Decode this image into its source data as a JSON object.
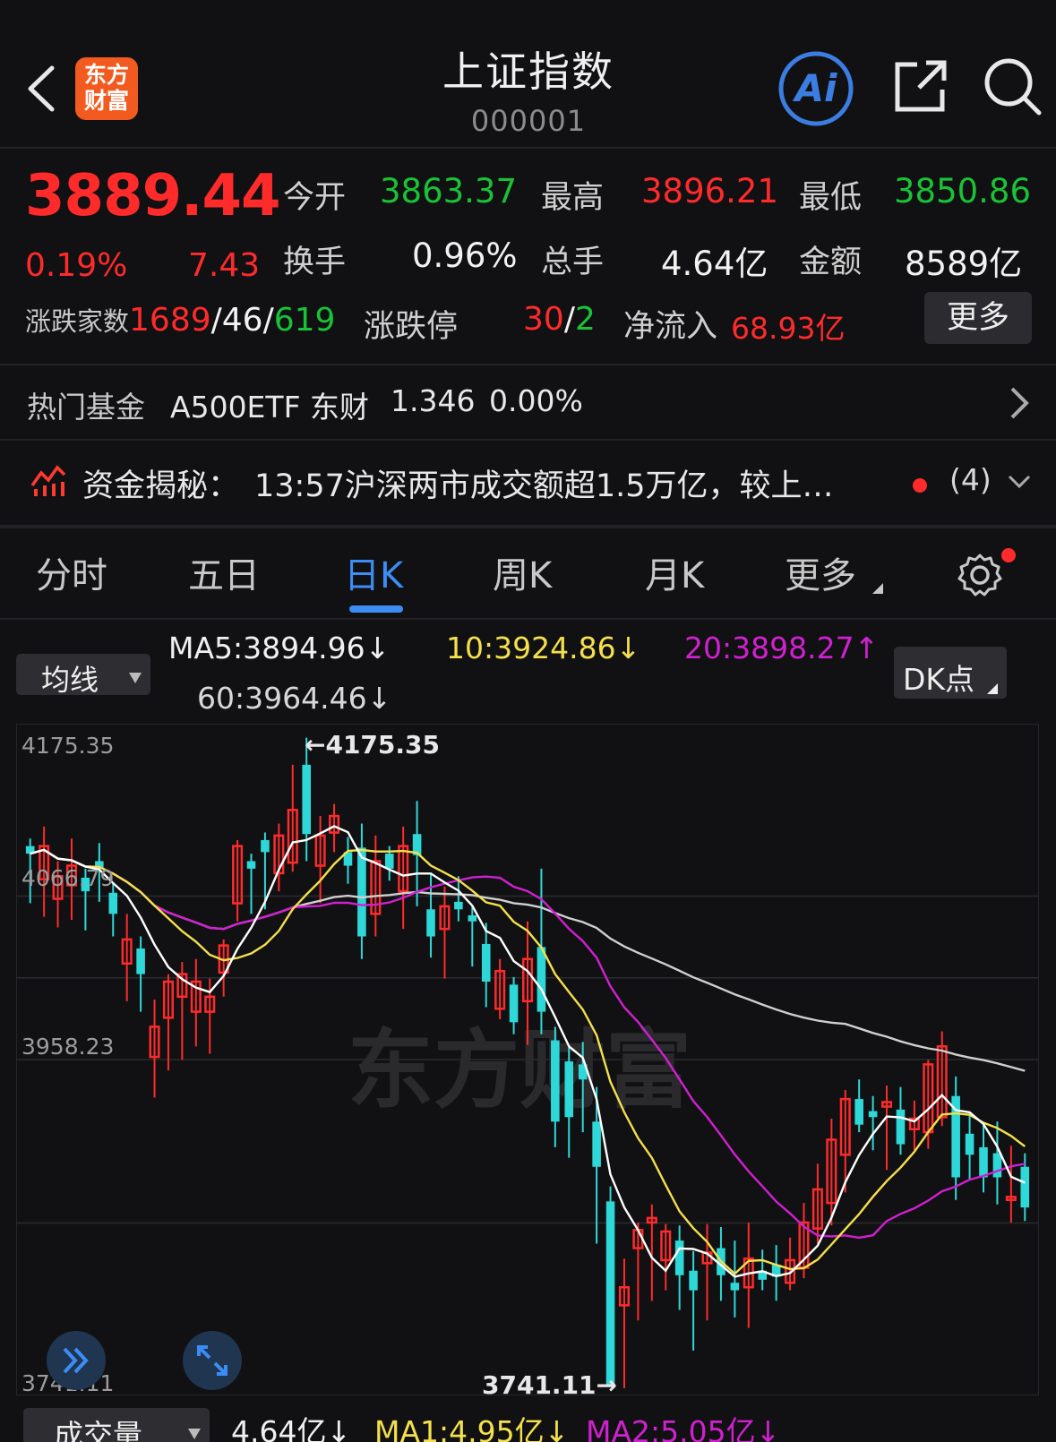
{
  "header": {
    "title": "上证指数",
    "code": "000001",
    "logo_text_line1": "东方",
    "logo_text_line2": "财富",
    "ai_label": "Ai"
  },
  "quote": {
    "price": "3889.44",
    "change_pct": "0.19%",
    "change_abs": "7.43",
    "open_label": "今开",
    "open": "3863.37",
    "high_label": "最高",
    "high": "3896.21",
    "low_label": "最低",
    "low": "3850.86",
    "turnover_label": "换手",
    "turnover": "0.96%",
    "volume_label": "总手",
    "volume": "4.64亿",
    "amount_label": "金额",
    "amount": "8589亿",
    "breadth_label": "涨跌家数",
    "breadth_up": "1689",
    "breadth_flat": "46",
    "breadth_down": "619",
    "limit_label": "涨跌停",
    "limit_up": "30",
    "limit_down": "2",
    "inflow_label": "净流入",
    "inflow": "68.93亿",
    "more_label": "更多",
    "sep": "/"
  },
  "hot_fund": {
    "label": "热门基金",
    "name": "A500ETF 东财",
    "price": "1.346",
    "pct": "0.00%"
  },
  "news": {
    "title": "资金揭秘：",
    "text": "13:57沪深两市成交额超1.5万亿，较上…",
    "count": "(4)"
  },
  "tabs": [
    "分时",
    "五日",
    "日K",
    "周K",
    "月K",
    "更多"
  ],
  "ma_bar": {
    "selector": "均线",
    "ma5": "MA5:3894.96↓",
    "ma10": "10:3924.86↓",
    "ma20": "20:3898.27↑",
    "ma60": "60:3964.46↓",
    "dk_label": "DK点"
  },
  "volume_bar": {
    "selector": "成交量",
    "vol": "4.64亿↓",
    "ma1": "MA1:4.95亿↓",
    "ma2": "MA2:5.05亿↓"
  },
  "colors": {
    "up": "#ff2b2b",
    "down": "#19c335",
    "candle_down": "#2fd8d8",
    "ma5": "#ffffff",
    "ma10": "#f4e04d",
    "ma20": "#d020d0",
    "ma60": "#cfcfcf",
    "accent": "#3b8df5"
  },
  "chart_data": {
    "type": "candlestick",
    "y_ticks": [
      "4175.35",
      "4066.79",
      "3958.23",
      "3741.11"
    ],
    "ylim": [
      3741.11,
      4175.35
    ],
    "high_marker": "←4175.35",
    "low_marker": "3741.11→",
    "watermark": "东方财富",
    "candles": [
      [
        4100,
        4095,
        4105,
        4062
      ],
      [
        4078,
        4100,
        4113,
        4053
      ],
      [
        4065,
        4080,
        4090,
        4046
      ],
      [
        4074,
        4087,
        4105,
        4051
      ],
      [
        4079,
        4070,
        4085,
        4044
      ],
      [
        4090,
        4085,
        4102,
        4063
      ],
      [
        4069,
        4055,
        4076,
        4040
      ],
      [
        4022,
        4038,
        4055,
        3997
      ],
      [
        4032,
        4015,
        4040,
        3990
      ],
      [
        3960,
        3980,
        3998,
        3933
      ],
      [
        3986,
        4010,
        4015,
        3951
      ],
      [
        4000,
        4015,
        4023,
        3958
      ],
      [
        3990,
        4010,
        4025,
        3967
      ],
      [
        3990,
        4000,
        4012,
        3962
      ],
      [
        4016,
        4034,
        4038,
        4000
      ],
      [
        4062,
        4100,
        4104,
        4050
      ],
      [
        4090,
        4085,
        4095,
        4055
      ],
      [
        4104,
        4096,
        4109,
        4058
      ],
      [
        4082,
        4107,
        4115,
        4070
      ],
      [
        4089,
        4124,
        4154,
        4083
      ],
      [
        4154,
        4108,
        4172,
        4090
      ],
      [
        4087,
        4107,
        4120,
        4062
      ],
      [
        4109,
        4120,
        4128,
        4096
      ],
      [
        4096,
        4087,
        4106,
        4075
      ],
      [
        4099,
        4040,
        4115,
        4025
      ],
      [
        4055,
        4090,
        4107,
        4040
      ],
      [
        4095,
        4085,
        4100,
        4077
      ],
      [
        4070,
        4100,
        4113,
        4045
      ],
      [
        4108,
        4094,
        4130,
        4060
      ],
      [
        4058,
        4040,
        4082,
        4026
      ],
      [
        4045,
        4060,
        4073,
        4012
      ],
      [
        4063,
        4058,
        4080,
        4050
      ],
      [
        4054,
        4050,
        4060,
        4020
      ],
      [
        4035,
        4010,
        4049,
        3993
      ],
      [
        3992,
        4017,
        4025,
        3985
      ],
      [
        4008,
        3983,
        4013,
        3975
      ],
      [
        3997,
        4025,
        4050,
        3968
      ],
      [
        4033,
        3990,
        4085,
        3975
      ],
      [
        3971,
        3917,
        3980,
        3900
      ],
      [
        3957,
        3920,
        3967,
        3893
      ],
      [
        3955,
        3945,
        3970,
        3910
      ],
      [
        3917,
        3887,
        3940,
        3836
      ],
      [
        3864,
        3741,
        3874,
        3741
      ],
      [
        3795,
        3807,
        3826,
        3740
      ],
      [
        3833,
        3845,
        3850,
        3785
      ],
      [
        3850,
        3853,
        3862,
        3798
      ],
      [
        3825,
        3844,
        3849,
        3805
      ],
      [
        3838,
        3815,
        3848,
        3792
      ],
      [
        3818,
        3805,
        3831,
        3765
      ],
      [
        3823,
        3830,
        3849,
        3785
      ],
      [
        3833,
        3815,
        3847,
        3798
      ],
      [
        3810,
        3805,
        3838,
        3787
      ],
      [
        3807,
        3826,
        3850,
        3780
      ],
      [
        3818,
        3812,
        3832,
        3805
      ],
      [
        3822,
        3814,
        3835,
        3798
      ],
      [
        3810,
        3825,
        3840,
        3805
      ],
      [
        3820,
        3850,
        3863,
        3813
      ],
      [
        3846,
        3872,
        3889,
        3836
      ],
      [
        3863,
        3905,
        3919,
        3848
      ],
      [
        3895,
        3932,
        3938,
        3870
      ],
      [
        3932,
        3915,
        3945,
        3910
      ],
      [
        3924,
        3920,
        3934,
        3898
      ],
      [
        3927,
        3930,
        3941,
        3885
      ],
      [
        3925,
        3902,
        3940,
        3895
      ],
      [
        3912,
        3919,
        3931,
        3898
      ],
      [
        3910,
        3955,
        3958,
        3899
      ],
      [
        3920,
        3967,
        3977,
        3914
      ],
      [
        3934,
        3880,
        3947,
        3865
      ],
      [
        3909,
        3895,
        3922,
        3878
      ],
      [
        3900,
        3880,
        3915,
        3870
      ],
      [
        3896,
        3880,
        3917,
        3862
      ],
      [
        3865,
        3867,
        3901,
        3850
      ],
      [
        3887,
        3860,
        3896,
        3851
      ]
    ]
  }
}
